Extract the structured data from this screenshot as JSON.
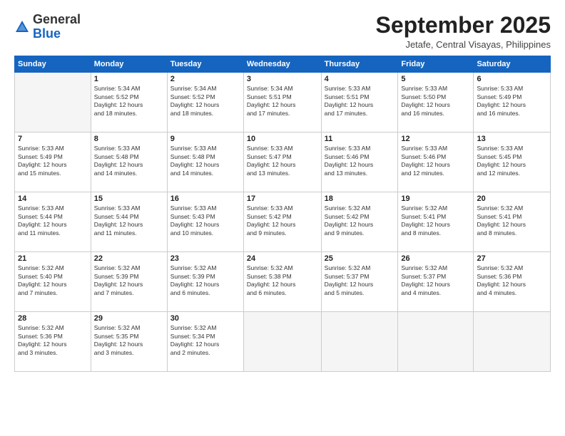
{
  "logo": {
    "general": "General",
    "blue": "Blue"
  },
  "header": {
    "month": "September 2025",
    "location": "Jetafe, Central Visayas, Philippines"
  },
  "days_of_week": [
    "Sunday",
    "Monday",
    "Tuesday",
    "Wednesday",
    "Thursday",
    "Friday",
    "Saturday"
  ],
  "weeks": [
    [
      {
        "day": "",
        "info": ""
      },
      {
        "day": "1",
        "info": "Sunrise: 5:34 AM\nSunset: 5:52 PM\nDaylight: 12 hours\nand 18 minutes."
      },
      {
        "day": "2",
        "info": "Sunrise: 5:34 AM\nSunset: 5:52 PM\nDaylight: 12 hours\nand 18 minutes."
      },
      {
        "day": "3",
        "info": "Sunrise: 5:34 AM\nSunset: 5:51 PM\nDaylight: 12 hours\nand 17 minutes."
      },
      {
        "day": "4",
        "info": "Sunrise: 5:33 AM\nSunset: 5:51 PM\nDaylight: 12 hours\nand 17 minutes."
      },
      {
        "day": "5",
        "info": "Sunrise: 5:33 AM\nSunset: 5:50 PM\nDaylight: 12 hours\nand 16 minutes."
      },
      {
        "day": "6",
        "info": "Sunrise: 5:33 AM\nSunset: 5:49 PM\nDaylight: 12 hours\nand 16 minutes."
      }
    ],
    [
      {
        "day": "7",
        "info": "Sunrise: 5:33 AM\nSunset: 5:49 PM\nDaylight: 12 hours\nand 15 minutes."
      },
      {
        "day": "8",
        "info": "Sunrise: 5:33 AM\nSunset: 5:48 PM\nDaylight: 12 hours\nand 14 minutes."
      },
      {
        "day": "9",
        "info": "Sunrise: 5:33 AM\nSunset: 5:48 PM\nDaylight: 12 hours\nand 14 minutes."
      },
      {
        "day": "10",
        "info": "Sunrise: 5:33 AM\nSunset: 5:47 PM\nDaylight: 12 hours\nand 13 minutes."
      },
      {
        "day": "11",
        "info": "Sunrise: 5:33 AM\nSunset: 5:46 PM\nDaylight: 12 hours\nand 13 minutes."
      },
      {
        "day": "12",
        "info": "Sunrise: 5:33 AM\nSunset: 5:46 PM\nDaylight: 12 hours\nand 12 minutes."
      },
      {
        "day": "13",
        "info": "Sunrise: 5:33 AM\nSunset: 5:45 PM\nDaylight: 12 hours\nand 12 minutes."
      }
    ],
    [
      {
        "day": "14",
        "info": "Sunrise: 5:33 AM\nSunset: 5:44 PM\nDaylight: 12 hours\nand 11 minutes."
      },
      {
        "day": "15",
        "info": "Sunrise: 5:33 AM\nSunset: 5:44 PM\nDaylight: 12 hours\nand 11 minutes."
      },
      {
        "day": "16",
        "info": "Sunrise: 5:33 AM\nSunset: 5:43 PM\nDaylight: 12 hours\nand 10 minutes."
      },
      {
        "day": "17",
        "info": "Sunrise: 5:33 AM\nSunset: 5:42 PM\nDaylight: 12 hours\nand 9 minutes."
      },
      {
        "day": "18",
        "info": "Sunrise: 5:32 AM\nSunset: 5:42 PM\nDaylight: 12 hours\nand 9 minutes."
      },
      {
        "day": "19",
        "info": "Sunrise: 5:32 AM\nSunset: 5:41 PM\nDaylight: 12 hours\nand 8 minutes."
      },
      {
        "day": "20",
        "info": "Sunrise: 5:32 AM\nSunset: 5:41 PM\nDaylight: 12 hours\nand 8 minutes."
      }
    ],
    [
      {
        "day": "21",
        "info": "Sunrise: 5:32 AM\nSunset: 5:40 PM\nDaylight: 12 hours\nand 7 minutes."
      },
      {
        "day": "22",
        "info": "Sunrise: 5:32 AM\nSunset: 5:39 PM\nDaylight: 12 hours\nand 7 minutes."
      },
      {
        "day": "23",
        "info": "Sunrise: 5:32 AM\nSunset: 5:39 PM\nDaylight: 12 hours\nand 6 minutes."
      },
      {
        "day": "24",
        "info": "Sunrise: 5:32 AM\nSunset: 5:38 PM\nDaylight: 12 hours\nand 6 minutes."
      },
      {
        "day": "25",
        "info": "Sunrise: 5:32 AM\nSunset: 5:37 PM\nDaylight: 12 hours\nand 5 minutes."
      },
      {
        "day": "26",
        "info": "Sunrise: 5:32 AM\nSunset: 5:37 PM\nDaylight: 12 hours\nand 4 minutes."
      },
      {
        "day": "27",
        "info": "Sunrise: 5:32 AM\nSunset: 5:36 PM\nDaylight: 12 hours\nand 4 minutes."
      }
    ],
    [
      {
        "day": "28",
        "info": "Sunrise: 5:32 AM\nSunset: 5:36 PM\nDaylight: 12 hours\nand 3 minutes."
      },
      {
        "day": "29",
        "info": "Sunrise: 5:32 AM\nSunset: 5:35 PM\nDaylight: 12 hours\nand 3 minutes."
      },
      {
        "day": "30",
        "info": "Sunrise: 5:32 AM\nSunset: 5:34 PM\nDaylight: 12 hours\nand 2 minutes."
      },
      {
        "day": "",
        "info": ""
      },
      {
        "day": "",
        "info": ""
      },
      {
        "day": "",
        "info": ""
      },
      {
        "day": "",
        "info": ""
      }
    ]
  ]
}
